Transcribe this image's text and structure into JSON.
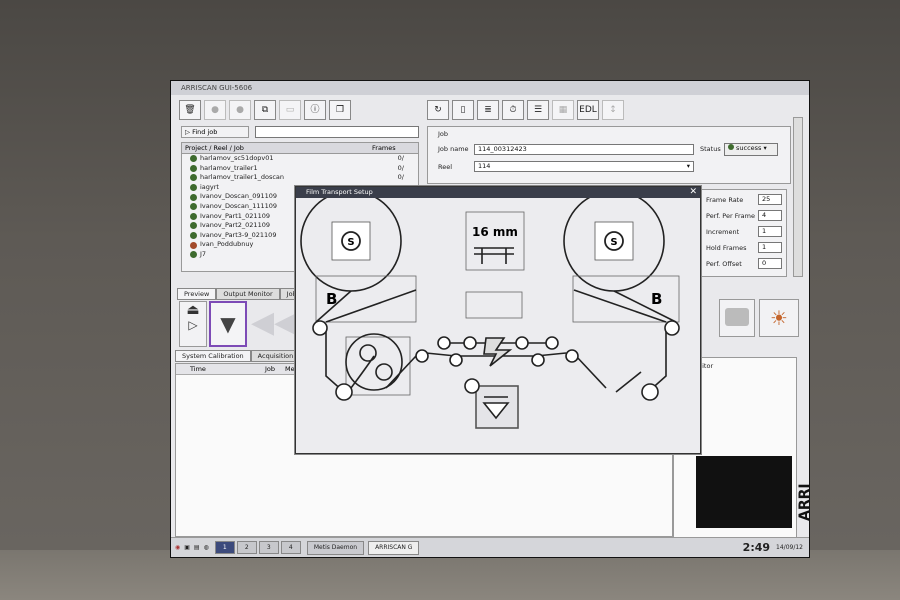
{
  "window": {
    "title": "ARRISCAN GUI-5606"
  },
  "toolbar_left": {
    "buttons": [
      "delete",
      "record",
      "stop",
      "copy",
      "comment",
      "info",
      "windows"
    ]
  },
  "toolbar_right": {
    "buttons": [
      "refresh",
      "page",
      "stack",
      "timecode",
      "list",
      "film",
      "EDL",
      "sort"
    ]
  },
  "find_job": {
    "label": "Find job"
  },
  "tree": {
    "col_project": "Project / Reel / Job",
    "col_frames": "Frames",
    "items": [
      {
        "name": "harlamov_sc51dopv01",
        "frames": "0/",
        "status": "green"
      },
      {
        "name": "harlamov_trailer1",
        "frames": "0/",
        "status": "green"
      },
      {
        "name": "harlamov_trailer1_doscan",
        "frames": "0/",
        "status": "green"
      },
      {
        "name": "iagyrt",
        "frames": "",
        "status": "green"
      },
      {
        "name": "Ivanov_Doscan_091109",
        "frames": "",
        "status": "green"
      },
      {
        "name": "Ivanov_Doscan_111109",
        "frames": "",
        "status": "green"
      },
      {
        "name": "Ivanov_Part1_021109",
        "frames": "",
        "status": "green"
      },
      {
        "name": "Ivanov_Part2_021109",
        "frames": "",
        "status": "green"
      },
      {
        "name": "Ivanov_Part3-9_021109",
        "frames": "",
        "status": "green"
      },
      {
        "name": "Ivan_Poddubnuy",
        "frames": "",
        "status": "red"
      },
      {
        "name": "J7",
        "frames": "",
        "status": "green"
      }
    ]
  },
  "tabs_mid": [
    "Preview",
    "Output Monitor",
    "Job"
  ],
  "tabs_bottom": [
    "System Calibration",
    "Acquisition"
  ],
  "log_columns": [
    "Time",
    "Job",
    "Me"
  ],
  "job": {
    "group_label": "Job",
    "job_name_label": "Job name",
    "job_name_value": "114_00312423",
    "reel_label": "Reel",
    "reel_value": "114",
    "status_label": "Status",
    "status_value": "success"
  },
  "settings": [
    {
      "label": "Frame Rate",
      "value": "25"
    },
    {
      "label": "Perf. Per Frame",
      "value": "4"
    },
    {
      "label": "Increment",
      "value": "1"
    },
    {
      "label": "Hold Frames",
      "value": "1"
    },
    {
      "label": "Perf. Offset",
      "value": "0"
    }
  ],
  "monitor_label": "nitor",
  "dialog": {
    "title": "Film Transport Setup",
    "gauge": "16 mm",
    "reel_left_badge": "S",
    "reel_right_badge": "S",
    "left_side": "B",
    "right_side": "B"
  },
  "taskbar": {
    "workspaces": [
      "1",
      "2",
      "3",
      "4"
    ],
    "tasks": [
      "Metis Daemon",
      "ARRISCAN G"
    ],
    "clock": "2:49",
    "date": "14/09/12"
  },
  "brand": "ARRI"
}
